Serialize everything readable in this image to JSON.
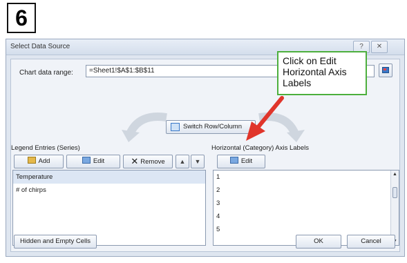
{
  "step_number": "6",
  "dialog": {
    "title": "Select Data Source",
    "help_icon": "help-icon",
    "close_icon": "close-icon",
    "chart_range_label": "Chart data range:",
    "chart_range_value": "=Sheet1!$A$1:$B$11",
    "switch_button": "Switch Row/Column",
    "legend_entries_label": "Legend Entries (Series)",
    "legend_toolbar": {
      "add": "Add",
      "edit": "Edit",
      "remove": "Remove",
      "up": "▲",
      "down": "▼"
    },
    "legend_items": [
      "Temperature",
      "# of chirps"
    ],
    "axis_labels_label": "Horizontal (Category) Axis Labels",
    "axis_edit": "Edit",
    "axis_items": [
      "1",
      "2",
      "3",
      "4",
      "5"
    ],
    "hidden_cells_button": "Hidden and Empty Cells",
    "ok_button": "OK",
    "cancel_button": "Cancel"
  },
  "callout": {
    "text": "Click on Edit Horizontal Axis Labels",
    "border_color": "#4caf3c",
    "arrow_color": "#e0352b"
  }
}
